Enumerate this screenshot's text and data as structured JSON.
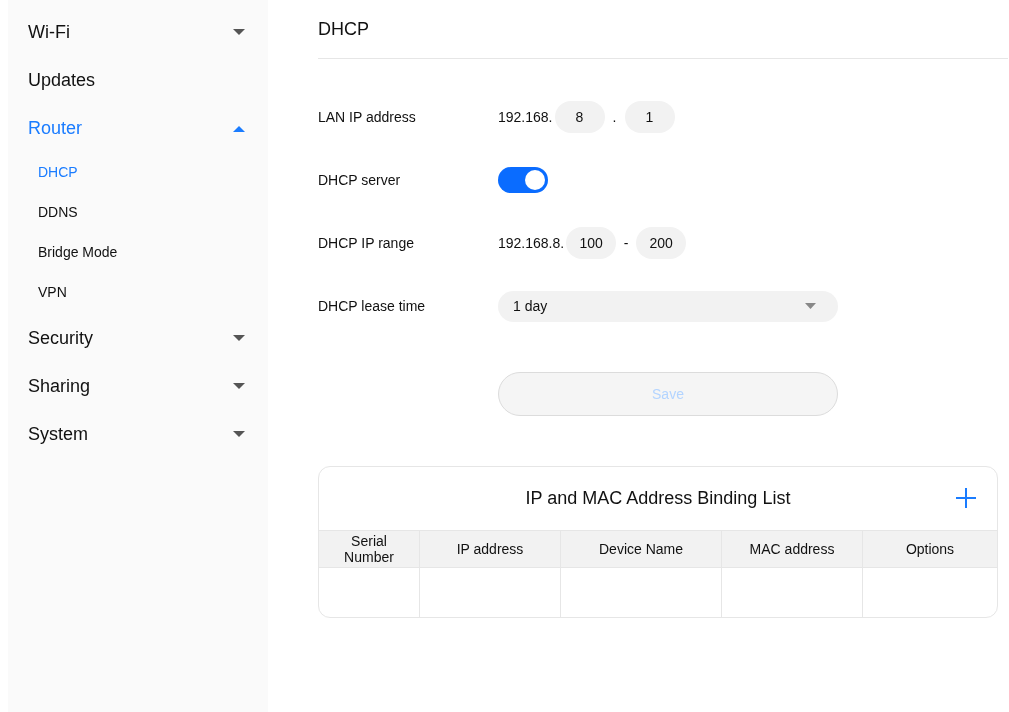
{
  "sidebar": {
    "items": [
      {
        "label": "Wi-Fi",
        "kind": "group",
        "expanded": false,
        "selected": false
      },
      {
        "label": "Updates",
        "kind": "link",
        "selected": false
      },
      {
        "label": "Router",
        "kind": "group",
        "expanded": true,
        "selected": true,
        "children": [
          {
            "label": "DHCP",
            "selected": true
          },
          {
            "label": "DDNS",
            "selected": false
          },
          {
            "label": "Bridge Mode",
            "selected": false
          },
          {
            "label": "VPN",
            "selected": false
          }
        ]
      },
      {
        "label": "Security",
        "kind": "group",
        "expanded": false,
        "selected": false
      },
      {
        "label": "Sharing",
        "kind": "group",
        "expanded": false,
        "selected": false
      },
      {
        "label": "System",
        "kind": "group",
        "expanded": false,
        "selected": false
      }
    ]
  },
  "page": {
    "title": "DHCP"
  },
  "form": {
    "rows": [
      {
        "kind": "ip",
        "label": "LAN IP address",
        "prefix": "192.168.",
        "fields": [
          "8",
          "1"
        ],
        "separator": "."
      },
      {
        "kind": "toggle",
        "label": "DHCP server",
        "on": true
      },
      {
        "kind": "ip",
        "label": "DHCP IP range",
        "prefix": "192.168.8.",
        "fields": [
          "100",
          "200"
        ],
        "separator": "-"
      },
      {
        "kind": "select",
        "label": "DHCP lease time",
        "value": "1 day"
      }
    ],
    "save": {
      "label": "Save",
      "disabled": true
    }
  },
  "binding_list": {
    "title": "IP and MAC Address Binding List",
    "columns": [
      "Serial Number",
      "IP address",
      "Device Name",
      "MAC address",
      "Options"
    ]
  }
}
